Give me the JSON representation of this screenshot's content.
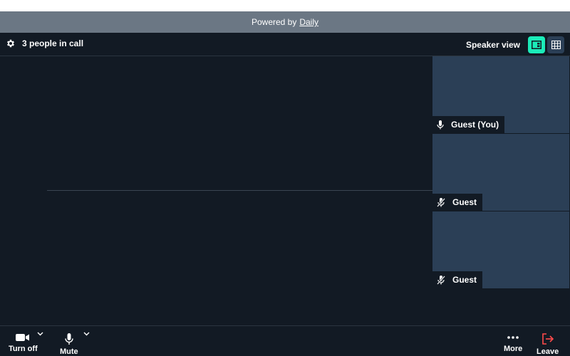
{
  "banner": {
    "prefix": "Powered by",
    "link": "Daily"
  },
  "topbar": {
    "people_count": "3 people in call",
    "view_label": "Speaker view",
    "settings_icon": "gear-icon",
    "speaker_view_icon": "speaker-view-icon",
    "grid_view_icon": "grid-view-icon"
  },
  "participants": [
    {
      "name": "Guest (You)",
      "mic": "on"
    },
    {
      "name": "Guest",
      "mic": "muted"
    },
    {
      "name": "Guest",
      "mic": "muted"
    }
  ],
  "tray": {
    "camera_label": "Turn off",
    "mic_label": "Mute",
    "more_label": "More",
    "leave_label": "Leave"
  },
  "colors": {
    "background": "#121a24",
    "tile": "#2b3f56",
    "banner": "#6b7784",
    "accent": "#1bebb9",
    "leave": "#ff4b4b"
  }
}
